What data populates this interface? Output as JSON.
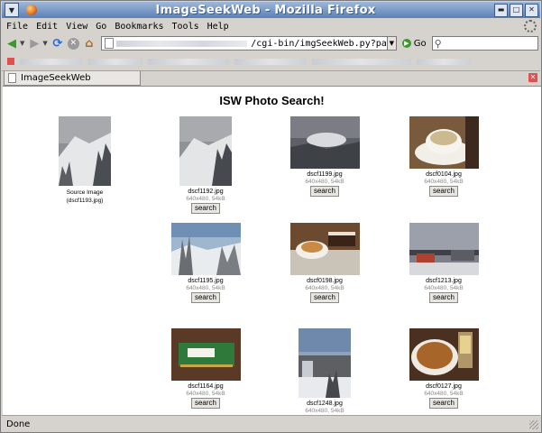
{
  "window": {
    "title": "ImageSeekWeb - Mozilla Firefox"
  },
  "menu": [
    "File",
    "Edit",
    "View",
    "Go",
    "Bookmarks",
    "Tools",
    "Help"
  ],
  "toolbar": {
    "url": "/cgi-bin/imgSeekWeb.py?pa",
    "go_label": "Go"
  },
  "tab": {
    "title": "ImageSeekWeb"
  },
  "page": {
    "heading": "ISW Photo Search!",
    "source": {
      "caption_line1": "Source Image",
      "caption_line2": "(dscf1193.jpg)"
    },
    "results": [
      {
        "name": "dscf1192.jpg",
        "meta": "640x480, 54kB",
        "button": "search"
      },
      {
        "name": "dscf1199.jpg",
        "meta": "640x480, 54kB",
        "button": "search"
      },
      {
        "name": "dscf0104.jpg",
        "meta": "640x480, 54kB",
        "button": "search"
      },
      {
        "name": "dscf1195.jpg",
        "meta": "640x480, 54kB",
        "button": "search"
      },
      {
        "name": "dscf0198.jpg",
        "meta": "640x480, 54kB",
        "button": "search"
      },
      {
        "name": "dscf1213.jpg",
        "meta": "640x480, 54kB",
        "button": "search"
      },
      {
        "name": "dscf1164.jpg",
        "meta": "640x480, 54kB",
        "button": "search"
      },
      {
        "name": "dscf1248.jpg",
        "meta": "640x480, 54kB",
        "button": "search"
      },
      {
        "name": "dscf0127.jpg",
        "meta": "640x480, 54kB",
        "button": "search"
      }
    ]
  },
  "status": {
    "text": "Done"
  }
}
